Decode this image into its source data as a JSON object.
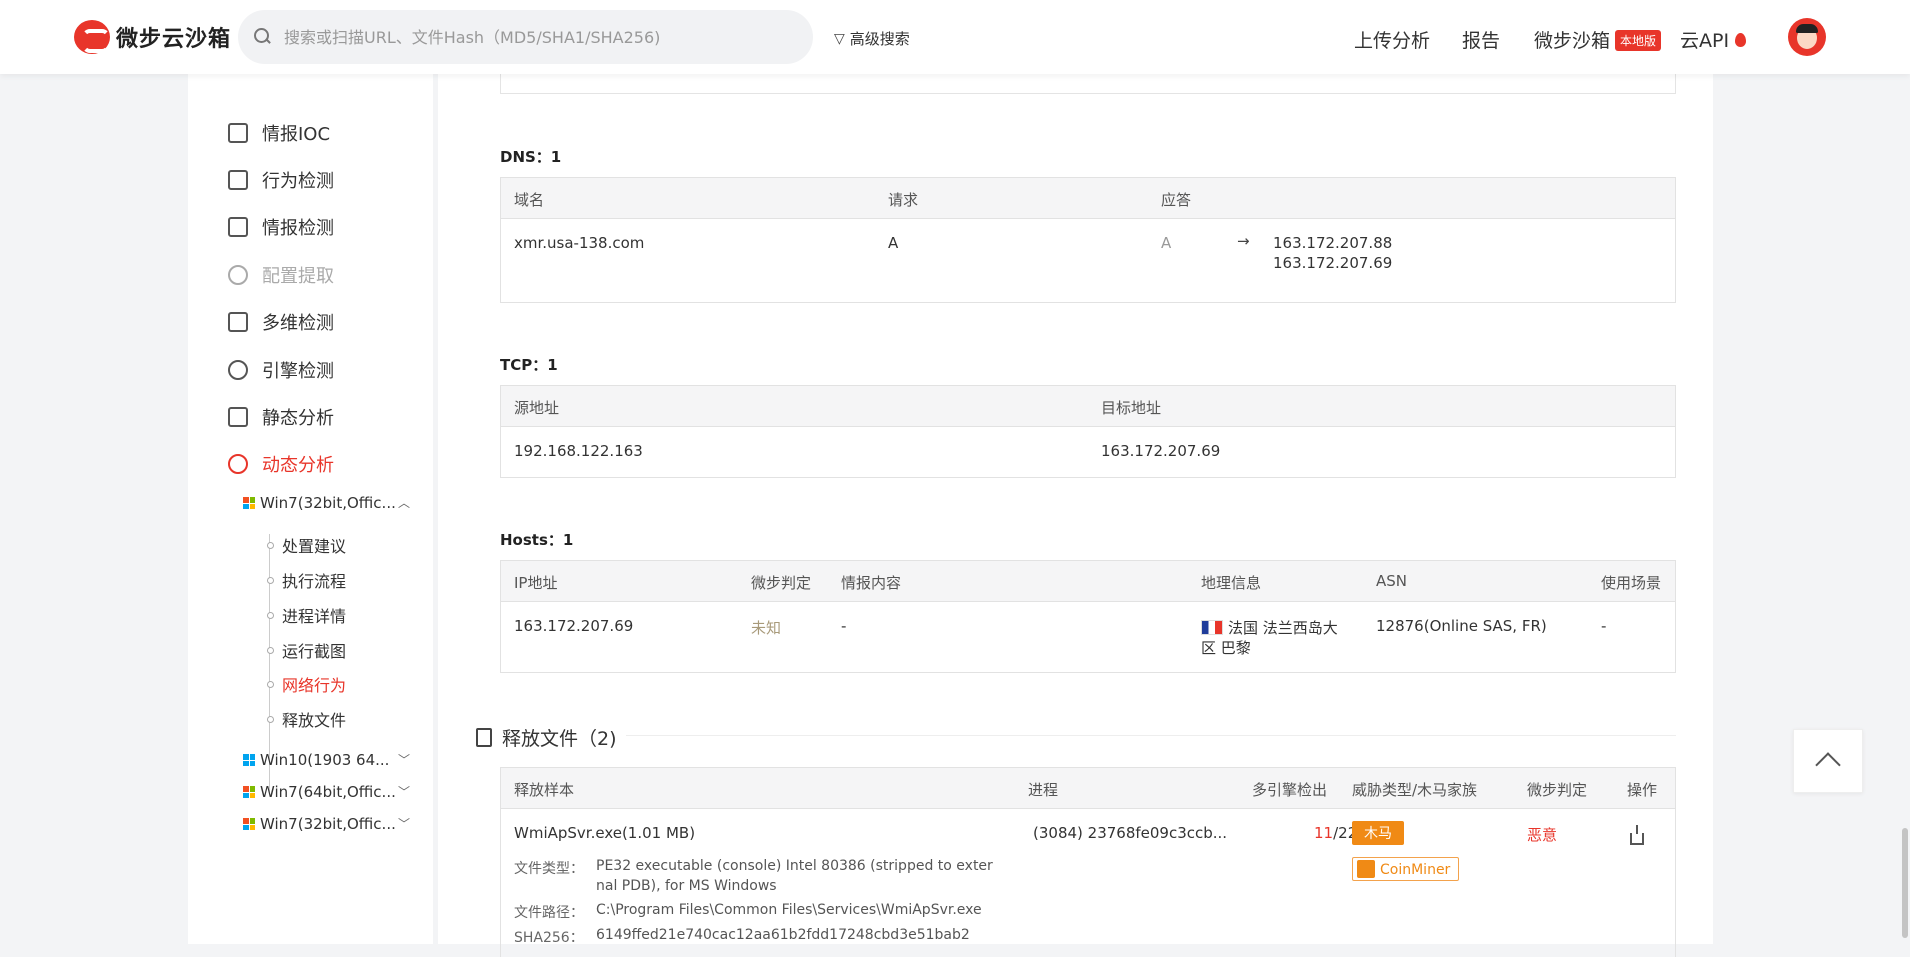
{
  "header": {
    "logo_text": "微步云沙箱",
    "search_placeholder": "搜索或扫描URL、文件Hash（MD5/SHA1/SHA256)",
    "advanced_search": "高级搜索",
    "nav": {
      "upload": "上传分析",
      "report": "报告",
      "sandbox": "微步沙箱",
      "sandbox_badge": "本地版",
      "cloud_api": "云API"
    }
  },
  "sidebar": {
    "items": [
      {
        "label": "情报IOC"
      },
      {
        "label": "行为检测"
      },
      {
        "label": "情报检测"
      },
      {
        "label": "配置提取"
      },
      {
        "label": "多维检测"
      },
      {
        "label": "引擎检测"
      },
      {
        "label": "静态分析"
      },
      {
        "label": "动态分析"
      }
    ],
    "vms": [
      {
        "label": "Win7(32bit,Offic..."
      },
      {
        "label": "Win10(1903 64..."
      },
      {
        "label": "Win7(64bit,Offic..."
      },
      {
        "label": "Win7(32bit,Offic..."
      }
    ],
    "sub_items": [
      {
        "label": "处置建议"
      },
      {
        "label": "执行流程"
      },
      {
        "label": "进程详情"
      },
      {
        "label": "运行截图"
      },
      {
        "label": "网络行为"
      },
      {
        "label": "释放文件"
      }
    ]
  },
  "dns": {
    "title": "DNS：1",
    "headers": [
      "域名",
      "请求",
      "应答"
    ],
    "row": {
      "domain": "xmr.usa-138.com",
      "request": "A",
      "answer_type": "A",
      "arrow": "→",
      "ip1": "163.172.207.88",
      "ip2": "163.172.207.69"
    }
  },
  "tcp": {
    "title": "TCP：1",
    "headers": [
      "源地址",
      "目标地址"
    ],
    "row": {
      "src": "192.168.122.163",
      "dst": "163.172.207.69"
    }
  },
  "hosts": {
    "title": "Hosts：1",
    "headers": [
      "IP地址",
      "微步判定",
      "情报内容",
      "地理信息",
      "ASN",
      "使用场景"
    ],
    "row": {
      "ip": "163.172.207.69",
      "verdict": "未知",
      "intel": "-",
      "geo_line1": "法国 法兰西岛大",
      "geo_line2": "区 巴黎",
      "asn": "12876(Online SAS, FR)",
      "usage": "-"
    }
  },
  "release": {
    "title": "释放文件（2)",
    "headers": [
      "释放样本",
      "进程",
      "多引擎检出",
      "威胁类型/木马家族",
      "微步判定",
      "操作"
    ],
    "row": {
      "name": "WmiApSvr.exe(1.01 MB)",
      "process": "(3084)  23768fe09c3ccb...",
      "detect_hit": "11",
      "detect_total": "/22",
      "type_tag": "木马",
      "family_tag": "CoinMiner",
      "verdict": "恶意",
      "file_type_label": "文件类型：",
      "file_type_1": "PE32 executable (console) Intel 80386 (stripped to exter",
      "file_type_2": "nal PDB), for MS Windows",
      "path_label": "文件路径：",
      "path": "C:\\Program Files\\Common Files\\Services\\WmiApSvr.exe",
      "sha_label": "SHA256：",
      "sha": "6149ffed21e740cac12aa61b2fdd17248cbd3e51bab2"
    }
  },
  "colors": {
    "accent": "#e8352a",
    "warning": "#f08a15",
    "unknown": "#a89a7a"
  }
}
